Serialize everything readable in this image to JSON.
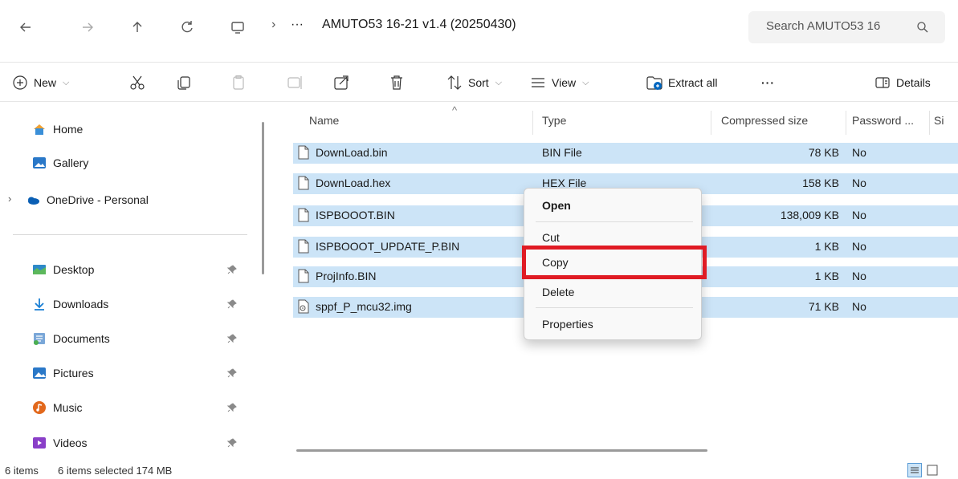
{
  "address_bar": {
    "overflow": "···",
    "path_current": "AMUTO53 16-21 v1.4 (20250430)",
    "search_placeholder": "Search AMUTO53 16"
  },
  "command_bar": {
    "new_label": "New",
    "sort_label": "Sort",
    "view_label": "View",
    "extract_label": "Extract all",
    "more_label": "···",
    "details_label": "Details"
  },
  "sidebar": {
    "top_items": [
      {
        "label": "Home",
        "icon": "home-icon"
      },
      {
        "label": "Gallery",
        "icon": "gallery-icon"
      },
      {
        "label": "OneDrive - Personal",
        "icon": "onedrive-icon"
      }
    ],
    "quick_items": [
      {
        "label": "Desktop",
        "icon": "desktop-icon"
      },
      {
        "label": "Downloads",
        "icon": "downloads-icon"
      },
      {
        "label": "Documents",
        "icon": "documents-icon"
      },
      {
        "label": "Pictures",
        "icon": "pictures-icon"
      },
      {
        "label": "Music",
        "icon": "music-icon"
      },
      {
        "label": "Videos",
        "icon": "videos-icon"
      }
    ]
  },
  "file_list": {
    "columns": [
      "Name",
      "Type",
      "Compressed size",
      "Password ...",
      "Si"
    ],
    "rows": [
      {
        "name": "DownLoad.bin",
        "type": "BIN File",
        "compressed_size": "78 KB",
        "password": "No"
      },
      {
        "name": "DownLoad.hex",
        "type": "HEX File",
        "compressed_size": "158 KB",
        "password": "No"
      },
      {
        "name": "ISPBOOOT.BIN",
        "type": "",
        "compressed_size": "138,009 KB",
        "password": "No"
      },
      {
        "name": "ISPBOOOT_UPDATE_P.BIN",
        "type": "",
        "compressed_size": "1 KB",
        "password": "No"
      },
      {
        "name": "ProjInfo.BIN",
        "type": "",
        "compressed_size": "1 KB",
        "password": "No"
      },
      {
        "name": "sppf_P_mcu32.img",
        "type": "",
        "compressed_size": "71 KB",
        "password": "No"
      }
    ]
  },
  "context_menu": {
    "items": [
      "Open",
      "Cut",
      "Copy",
      "Delete",
      "Properties"
    ],
    "highlighted": "Copy",
    "highlight_color": "#e01b24"
  },
  "status_bar": {
    "item_count": "6 items",
    "selection": "6 items selected  174 MB"
  },
  "colors": {
    "selection": "#cce4f7",
    "accent": "#0067c0"
  }
}
